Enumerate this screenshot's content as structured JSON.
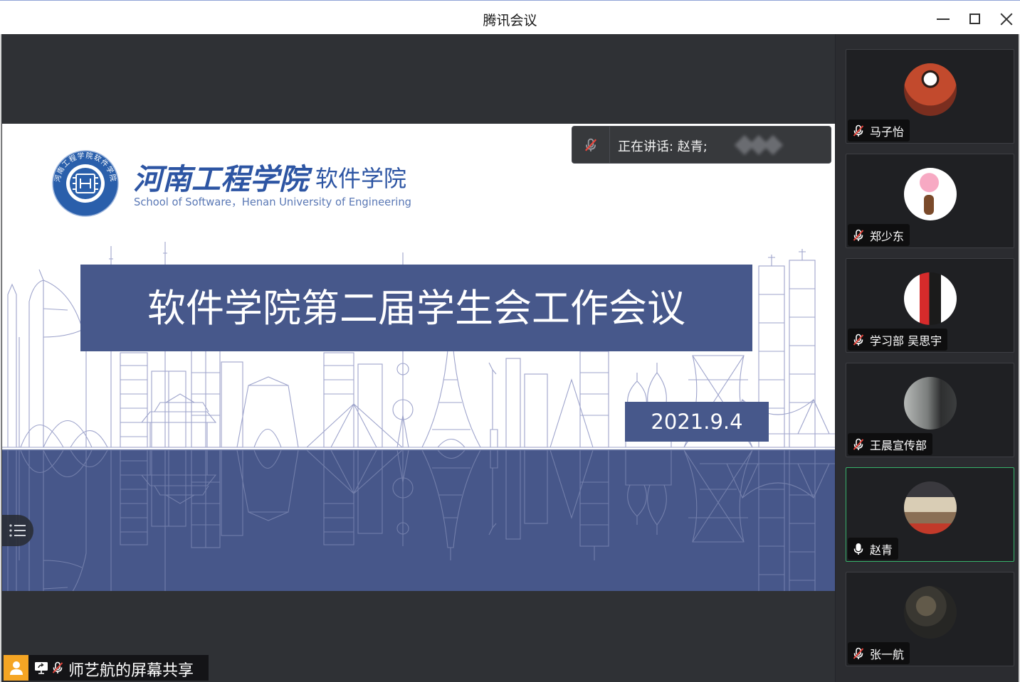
{
  "window": {
    "title": "腾讯会议"
  },
  "icons": {
    "minimize": "minimize-icon",
    "maximize": "maximize-icon",
    "close": "close-icon",
    "mic_muted": "mic-muted-icon",
    "mic_on": "mic-icon",
    "screen_share": "screen-share-icon",
    "person": "person-icon",
    "menu_list": "list-icon"
  },
  "colors": {
    "active_speaker_border": "#37b36b",
    "slide_blue": "#47588b",
    "logo_blue": "#2a5fab",
    "share_person_orange": "#f5a524",
    "muted_slash": "#e8453c"
  },
  "speaking": {
    "label": "正在讲话: 赵青;"
  },
  "share": {
    "label": "师艺航的屏幕共享"
  },
  "slide": {
    "logo_seal_text": "河南工程学院软件学院",
    "school_name": "河南工程学院",
    "college_name": "软件学院",
    "school_name_en": "School of Software，Henan University of Engineering",
    "title": "软件学院第二届学生会工作会议",
    "date": "2021.9.4"
  },
  "participants": [
    {
      "name": "马子怡",
      "muted": true,
      "active": false
    },
    {
      "name": "郑少东",
      "muted": true,
      "active": false
    },
    {
      "name": "学习部 吴思宇",
      "muted": true,
      "active": false
    },
    {
      "name": "王晨宣传部",
      "muted": true,
      "active": false
    },
    {
      "name": "赵青",
      "muted": false,
      "active": true
    },
    {
      "name": "张一航",
      "muted": true,
      "active": false
    }
  ]
}
